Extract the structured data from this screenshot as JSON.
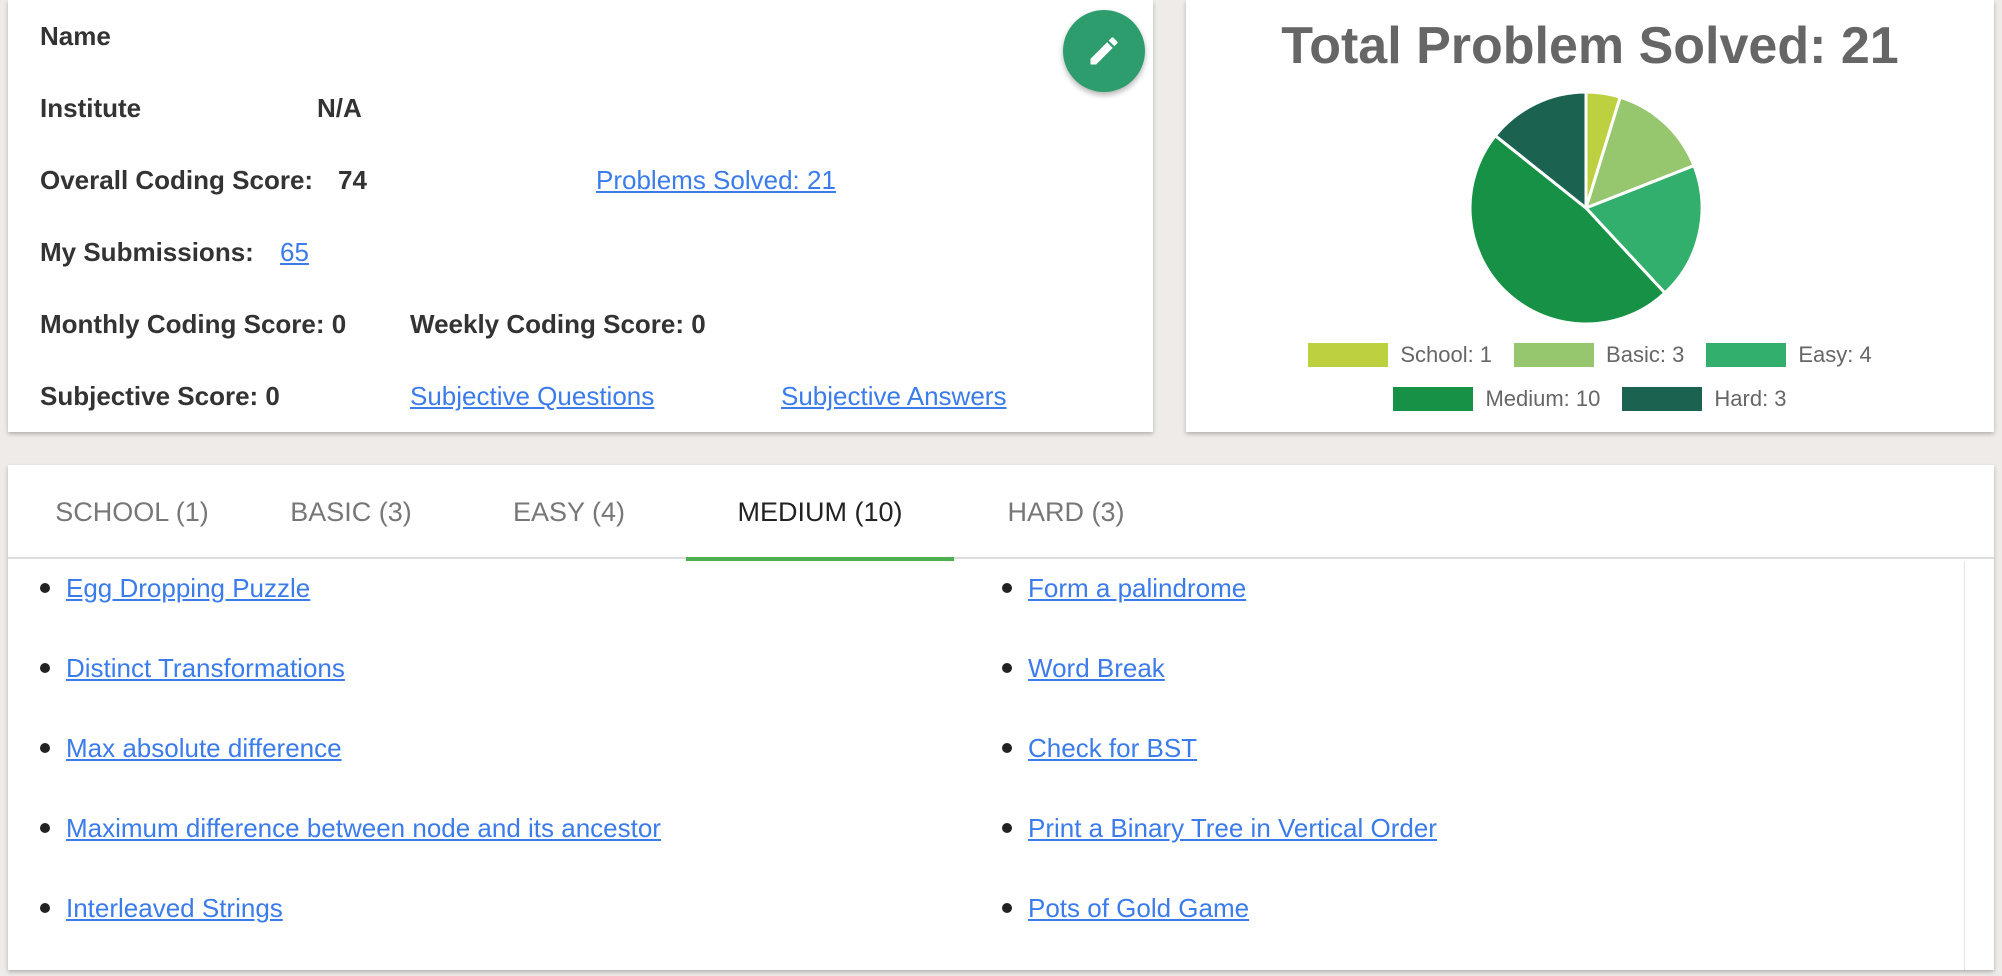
{
  "profile": {
    "name_label": "Name",
    "institute_label": "Institute",
    "institute_value": "N/A",
    "overall_label": "Overall Coding Score:",
    "overall_value": "74",
    "problems_solved_link": "Problems Solved:   21",
    "submissions_label": "My Submissions:",
    "submissions_value": "65",
    "monthly": "Monthly Coding Score: 0",
    "weekly": "Weekly Coding Score: 0",
    "subjective_score": "Subjective Score: 0",
    "subjective_questions": "Subjective Questions",
    "subjective_answers": "Subjective Answers",
    "edit_icon": "pencil-icon"
  },
  "chart_data": {
    "type": "pie",
    "title": "Total Problem Solved: 21",
    "slices": [
      {
        "label": "School: 1",
        "value": 1,
        "color": "#bcd040"
      },
      {
        "label": "Basic: 3",
        "value": 3,
        "color": "#96c76e"
      },
      {
        "label": "Easy: 4",
        "value": 4,
        "color": "#32ae6d"
      },
      {
        "label": "Medium: 10",
        "value": 10,
        "color": "#179146"
      },
      {
        "label": "Hard: 3",
        "value": 3,
        "color": "#1b6251"
      }
    ],
    "legend_position": "bottom"
  },
  "tabs": [
    {
      "label": "SCHOOL (1)"
    },
    {
      "label": "BASIC (3)"
    },
    {
      "label": "EASY (4)"
    },
    {
      "label": "MEDIUM (10)"
    },
    {
      "label": "HARD (3)"
    }
  ],
  "active_tab": "MEDIUM (10)",
  "accent_color": "#4caf50",
  "problems": {
    "left": [
      "Egg Dropping Puzzle",
      "Distinct Transformations",
      "Max absolute difference",
      "Maximum difference between node and its ancestor",
      "Interleaved Strings"
    ],
    "right": [
      "Form a palindrome",
      "Word Break",
      "Check for BST",
      "Print a Binary Tree in Vertical Order",
      "Pots of Gold Game"
    ]
  }
}
